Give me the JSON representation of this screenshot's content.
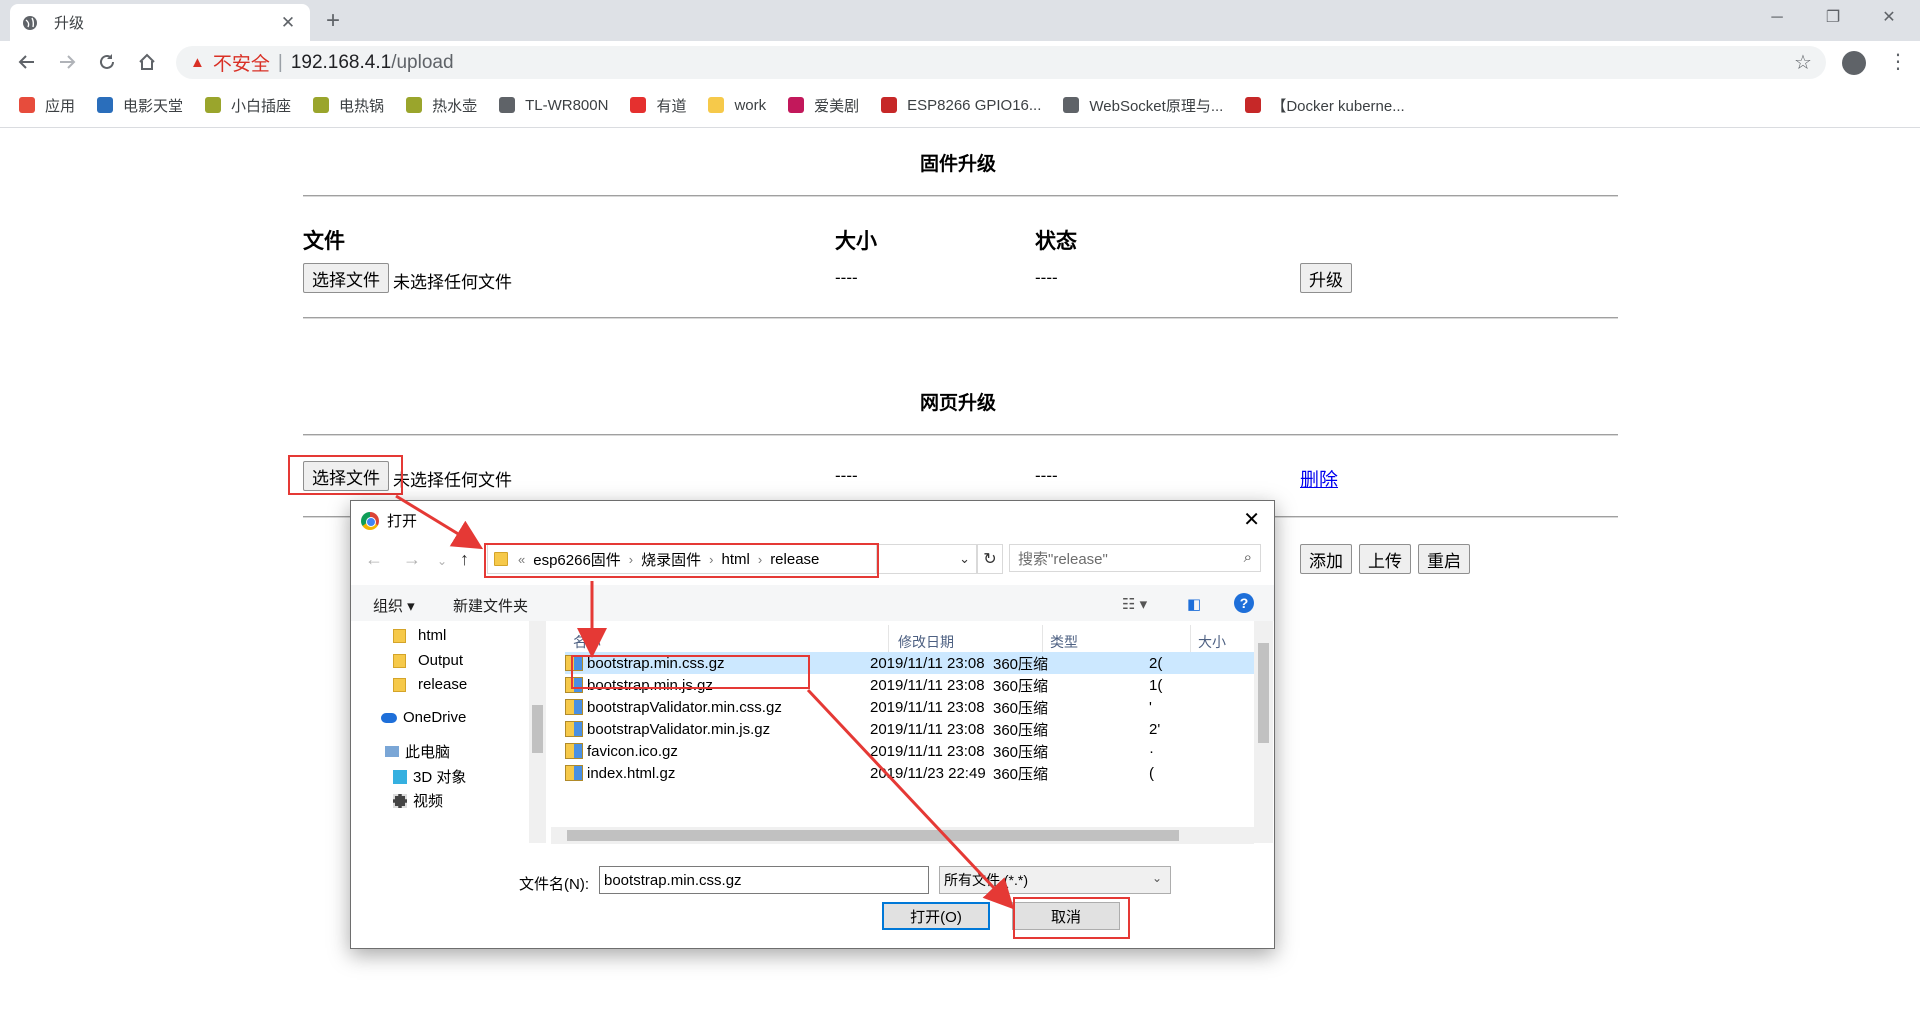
{
  "browser": {
    "tab_title": "升级",
    "insecure_label": "不安全",
    "url_host": "192.168.4.1",
    "url_path": "/upload",
    "bookmarks": [
      {
        "label": "应用",
        "color": "#e74c3c"
      },
      {
        "label": "电影天堂",
        "color": "#2a6ebb"
      },
      {
        "label": "小白插座",
        "color": "#9aa52c"
      },
      {
        "label": "电热锅",
        "color": "#9aa52c"
      },
      {
        "label": "热水壶",
        "color": "#9aa52c"
      },
      {
        "label": "TL-WR800N",
        "color": "#5f6368"
      },
      {
        "label": "有道",
        "color": "#e5302f"
      },
      {
        "label": "work",
        "color": "#f6c94a"
      },
      {
        "label": "爱美剧",
        "color": "#c2185b"
      },
      {
        "label": "ESP8266 GPIO16...",
        "color": "#c62828"
      },
      {
        "label": "WebSocket原理与...",
        "color": "#5f6368"
      },
      {
        "label": "【Docker kuberne...",
        "color": "#c62828"
      }
    ]
  },
  "page": {
    "firmware_title": "固件升级",
    "col_file": "文件",
    "col_size": "大小",
    "col_status": "状态",
    "choose_file": "选择文件",
    "no_file": "未选择任何文件",
    "dashes": "----",
    "upgrade_btn": "升级",
    "web_title": "网页升级",
    "delete_link": "删除",
    "add_btn": "添加",
    "upload_btn": "上传",
    "restart_btn": "重启"
  },
  "dialog": {
    "title": "打开",
    "breadcrumb": [
      "esp6266固件",
      "烧录固件",
      "html",
      "release"
    ],
    "breadcrumb_prefix": "«",
    "search_placeholder": "搜索\"release\"",
    "organize": "组织 ▾",
    "new_folder": "新建文件夹",
    "help": "?",
    "nav_items": [
      "html",
      "Output",
      "release",
      "OneDrive",
      "此电脑",
      "3D 对象",
      "视频"
    ],
    "headers": {
      "name": "名称",
      "date": "修改日期",
      "type": "类型",
      "size": "大小"
    },
    "files": [
      {
        "name": "bootstrap.min.css.gz",
        "date": "2019/11/11 23:08",
        "type": "360压缩",
        "size": "2("
      },
      {
        "name": "bootstrap.min.js.gz",
        "date": "2019/11/11 23:08",
        "type": "360压缩",
        "size": "1("
      },
      {
        "name": "bootstrapValidator.min.css.gz",
        "date": "2019/11/11 23:08",
        "type": "360压缩",
        "size": "'"
      },
      {
        "name": "bootstrapValidator.min.js.gz",
        "date": "2019/11/11 23:08",
        "type": "360压缩",
        "size": "2'"
      },
      {
        "name": "favicon.ico.gz",
        "date": "2019/11/11 23:08",
        "type": "360压缩",
        "size": "·"
      },
      {
        "name": "index.html.gz",
        "date": "2019/11/23 22:49",
        "type": "360压缩",
        "size": "("
      }
    ],
    "filename_label": "文件名(N):",
    "filename_value": "bootstrap.min.css.gz",
    "filetype": "所有文件 (*.*)",
    "open_btn": "打开(O)",
    "cancel_btn": "取消"
  },
  "annotation_color": "#e53935"
}
